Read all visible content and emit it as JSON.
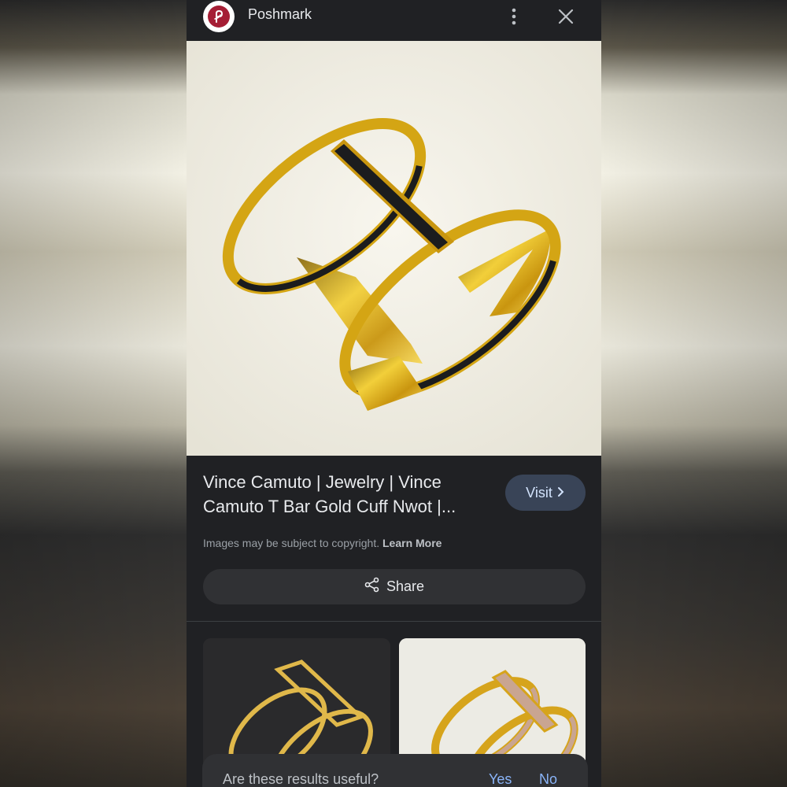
{
  "header": {
    "site_name": "Poshmark"
  },
  "result": {
    "title": "Vince Camuto | Jewelry | Vince Camuto T Bar Gold Cuff Nwot |...",
    "visit_label": "Visit",
    "copyright_text": "Images may be subject to copyright.",
    "learn_more_label": "Learn More",
    "share_label": "Share"
  },
  "feedback": {
    "question": "Are these results useful?",
    "yes_label": "Yes",
    "no_label": "No"
  },
  "colors": {
    "background": "#202124",
    "accent_link": "#8ab4f8",
    "visit_button": "#394457",
    "brand": "#a51e35"
  },
  "icons": [
    "poshmark-logo-icon",
    "more-vert-icon",
    "close-icon",
    "chevron-right-icon",
    "share-icon"
  ]
}
